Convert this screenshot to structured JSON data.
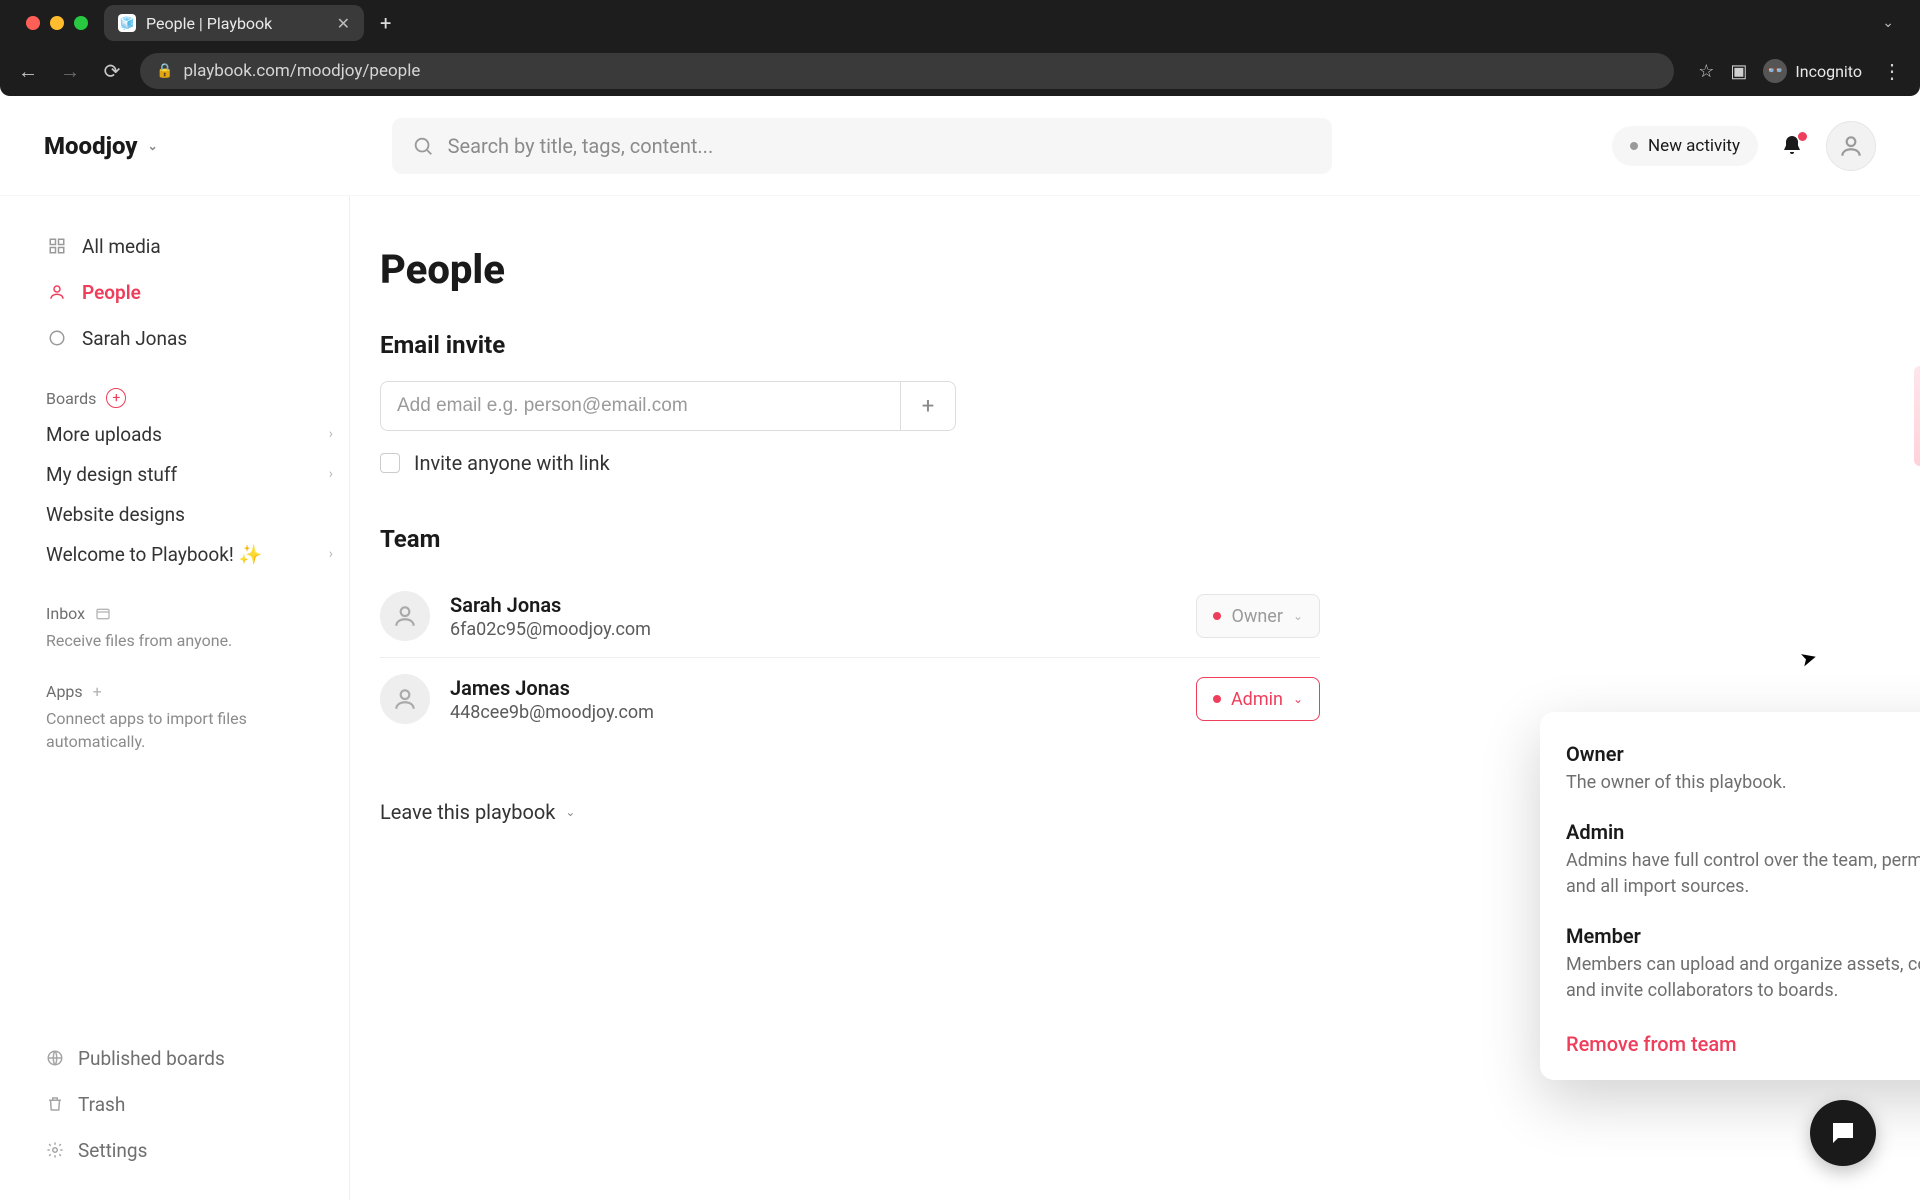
{
  "browser": {
    "tab_title": "People | Playbook",
    "url": "playbook.com/moodjoy/people",
    "incognito_label": "Incognito"
  },
  "header": {
    "workspace": "Moodjoy",
    "search_placeholder": "Search by title, tags, content...",
    "activity_label": "New activity"
  },
  "sidebar": {
    "nav": [
      {
        "label": "All media"
      },
      {
        "label": "People"
      },
      {
        "label": "Sarah Jonas"
      }
    ],
    "boards_header": "Boards",
    "boards": [
      {
        "label": "More uploads",
        "has_children": true
      },
      {
        "label": "My design stuff",
        "has_children": true
      },
      {
        "label": "Website designs",
        "has_children": false
      },
      {
        "label": "Welcome to Playbook! ✨",
        "has_children": true
      }
    ],
    "inbox_header": "Inbox",
    "inbox_sub": "Receive files from anyone.",
    "apps_header": "Apps",
    "apps_sub": "Connect apps to import files automatically.",
    "footer": [
      {
        "label": "Published boards"
      },
      {
        "label": "Trash"
      },
      {
        "label": "Settings"
      }
    ]
  },
  "main": {
    "title": "People",
    "invite_heading": "Email invite",
    "email_placeholder": "Add email e.g. person@email.com",
    "invite_link_label": "Invite anyone with link",
    "team_heading": "Team",
    "team": [
      {
        "name": "Sarah Jonas",
        "email": "6fa02c95@moodjoy.com",
        "role": "Owner"
      },
      {
        "name": "James Jonas",
        "email": "448cee9b@moodjoy.com",
        "role": "Admin"
      }
    ],
    "leave_label": "Leave this playbook"
  },
  "role_menu": {
    "options": [
      {
        "title": "Owner",
        "desc": "The owner of this playbook."
      },
      {
        "title": "Admin",
        "desc": "Admins have full control over the team, permissions, and all import sources."
      },
      {
        "title": "Member",
        "desc": "Members can upload and organize assets, comment, and invite collaborators to boards."
      }
    ],
    "remove_label": "Remove from team"
  }
}
